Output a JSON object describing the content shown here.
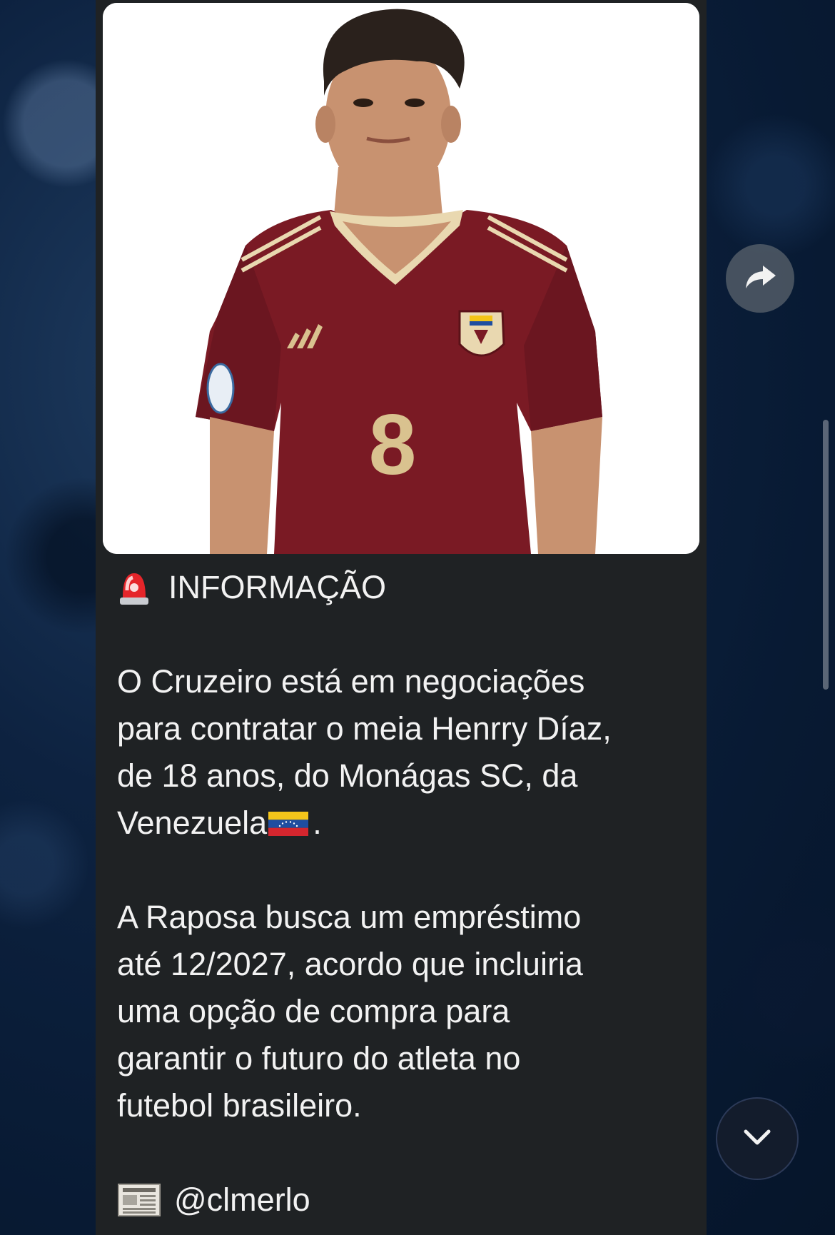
{
  "message": {
    "heading": "INFORMAÇÃO",
    "heading_icon": "police-light-emoji",
    "paragraph1": {
      "lines": [
        "O Cruzeiro está em negociações",
        "para contratar o meia Henrry Díaz,",
        "de 18 anos, do Monágas SC, da"
      ],
      "last_line_before_flag": "Venezuela",
      "flag": "venezuela-flag-emoji",
      "last_line_after_flag": "."
    },
    "paragraph2": {
      "lines": [
        "A Raposa busca um empréstimo",
        "até 12/2027, acordo que incluiria",
        "uma opção de compra para",
        "garantir o futuro do atleta no",
        "futebol brasileiro."
      ]
    },
    "credit": {
      "icon": "newspaper-emoji",
      "text": "@clmerlo"
    },
    "photo": {
      "jersey_number": "8",
      "jersey_color": "#7a1a24",
      "trim_color": "#e9d8b0"
    }
  },
  "colors": {
    "bubble": "#1f2224",
    "text": "#f2f2f2",
    "background": "#0d2240"
  },
  "controls": {
    "share_icon": "share-arrow-icon",
    "scroll_icon": "chevron-down-icon"
  }
}
